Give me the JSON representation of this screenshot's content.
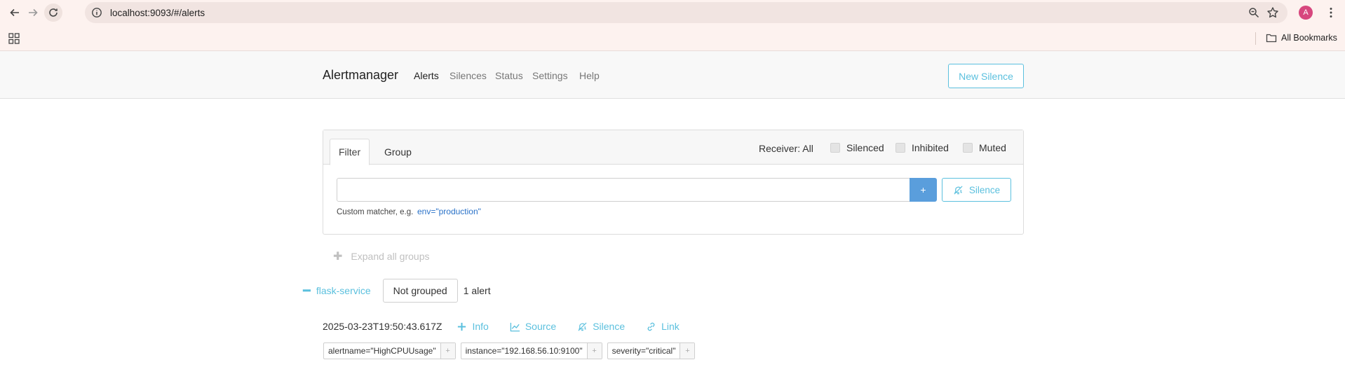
{
  "browser": {
    "url": "localhost:9093/#/alerts",
    "avatar_letter": "A",
    "bookmarks_label": "All Bookmarks"
  },
  "nav": {
    "brand": "Alertmanager",
    "links": [
      "Alerts",
      "Silences",
      "Status",
      "Settings",
      "Help"
    ],
    "active": "Alerts",
    "new_silence": "New Silence"
  },
  "filter": {
    "tabs": [
      "Filter",
      "Group"
    ],
    "active_tab": "Filter",
    "receiver": "Receiver: All",
    "checkboxes": [
      "Silenced",
      "Inhibited",
      "Muted"
    ],
    "input_value": "",
    "add_label": "+",
    "silence_label": "Silence",
    "hint_text": "Custom matcher, e.g.",
    "hint_example": "env=\"production\""
  },
  "groups": {
    "expand_all": "Expand all groups",
    "group_name": "flask-service",
    "grouping": "Not grouped",
    "count": "1 alert"
  },
  "alert": {
    "timestamp": "2025-03-23T19:50:43.617Z",
    "actions": [
      "Info",
      "Source",
      "Silence",
      "Link"
    ],
    "labels": [
      "alertname=\"HighCPUUsage\"",
      "instance=\"192.168.56.10:9100\"",
      "severity=\"critical\""
    ],
    "label_add": "+"
  },
  "colors": {
    "accent": "#5bc0de",
    "primary_button": "#5a9edc",
    "link_blue": "#2a72c8",
    "avatar": "#d7477e"
  }
}
